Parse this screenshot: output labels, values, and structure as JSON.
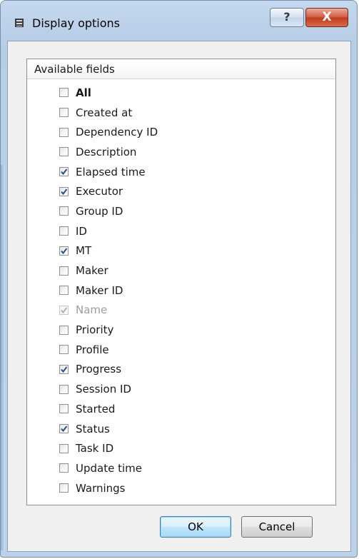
{
  "window": {
    "title": "Display options",
    "help_label": "?",
    "close_label": "X"
  },
  "fields_panel": {
    "header": "Available fields",
    "items": [
      {
        "label": "All",
        "checked": false,
        "bold": true,
        "disabled": false
      },
      {
        "label": "Created at",
        "checked": false,
        "bold": false,
        "disabled": false
      },
      {
        "label": "Dependency ID",
        "checked": false,
        "bold": false,
        "disabled": false
      },
      {
        "label": "Description",
        "checked": false,
        "bold": false,
        "disabled": false
      },
      {
        "label": "Elapsed time",
        "checked": true,
        "bold": false,
        "disabled": false
      },
      {
        "label": "Executor",
        "checked": true,
        "bold": false,
        "disabled": false
      },
      {
        "label": "Group ID",
        "checked": false,
        "bold": false,
        "disabled": false
      },
      {
        "label": "ID",
        "checked": false,
        "bold": false,
        "disabled": false
      },
      {
        "label": "MT",
        "checked": true,
        "bold": false,
        "disabled": false
      },
      {
        "label": "Maker",
        "checked": false,
        "bold": false,
        "disabled": false
      },
      {
        "label": "Maker ID",
        "checked": false,
        "bold": false,
        "disabled": false
      },
      {
        "label": "Name",
        "checked": true,
        "bold": false,
        "disabled": true
      },
      {
        "label": "Priority",
        "checked": false,
        "bold": false,
        "disabled": false
      },
      {
        "label": "Profile",
        "checked": false,
        "bold": false,
        "disabled": false
      },
      {
        "label": "Progress",
        "checked": true,
        "bold": false,
        "disabled": false
      },
      {
        "label": "Session ID",
        "checked": false,
        "bold": false,
        "disabled": false
      },
      {
        "label": "Started",
        "checked": false,
        "bold": false,
        "disabled": false
      },
      {
        "label": "Status",
        "checked": true,
        "bold": false,
        "disabled": false
      },
      {
        "label": "Task ID",
        "checked": false,
        "bold": false,
        "disabled": false
      },
      {
        "label": "Update time",
        "checked": false,
        "bold": false,
        "disabled": false
      },
      {
        "label": "Warnings",
        "checked": false,
        "bold": false,
        "disabled": false
      }
    ]
  },
  "buttons": {
    "ok_label": "OK",
    "cancel_label": "Cancel"
  },
  "colors": {
    "check_mark": "#2a4f8a",
    "check_mark_disabled": "#b0b0b0"
  },
  "icons": {
    "app": "application-icon",
    "help": "help-icon",
    "close": "close-icon",
    "check": "checkmark-icon"
  }
}
